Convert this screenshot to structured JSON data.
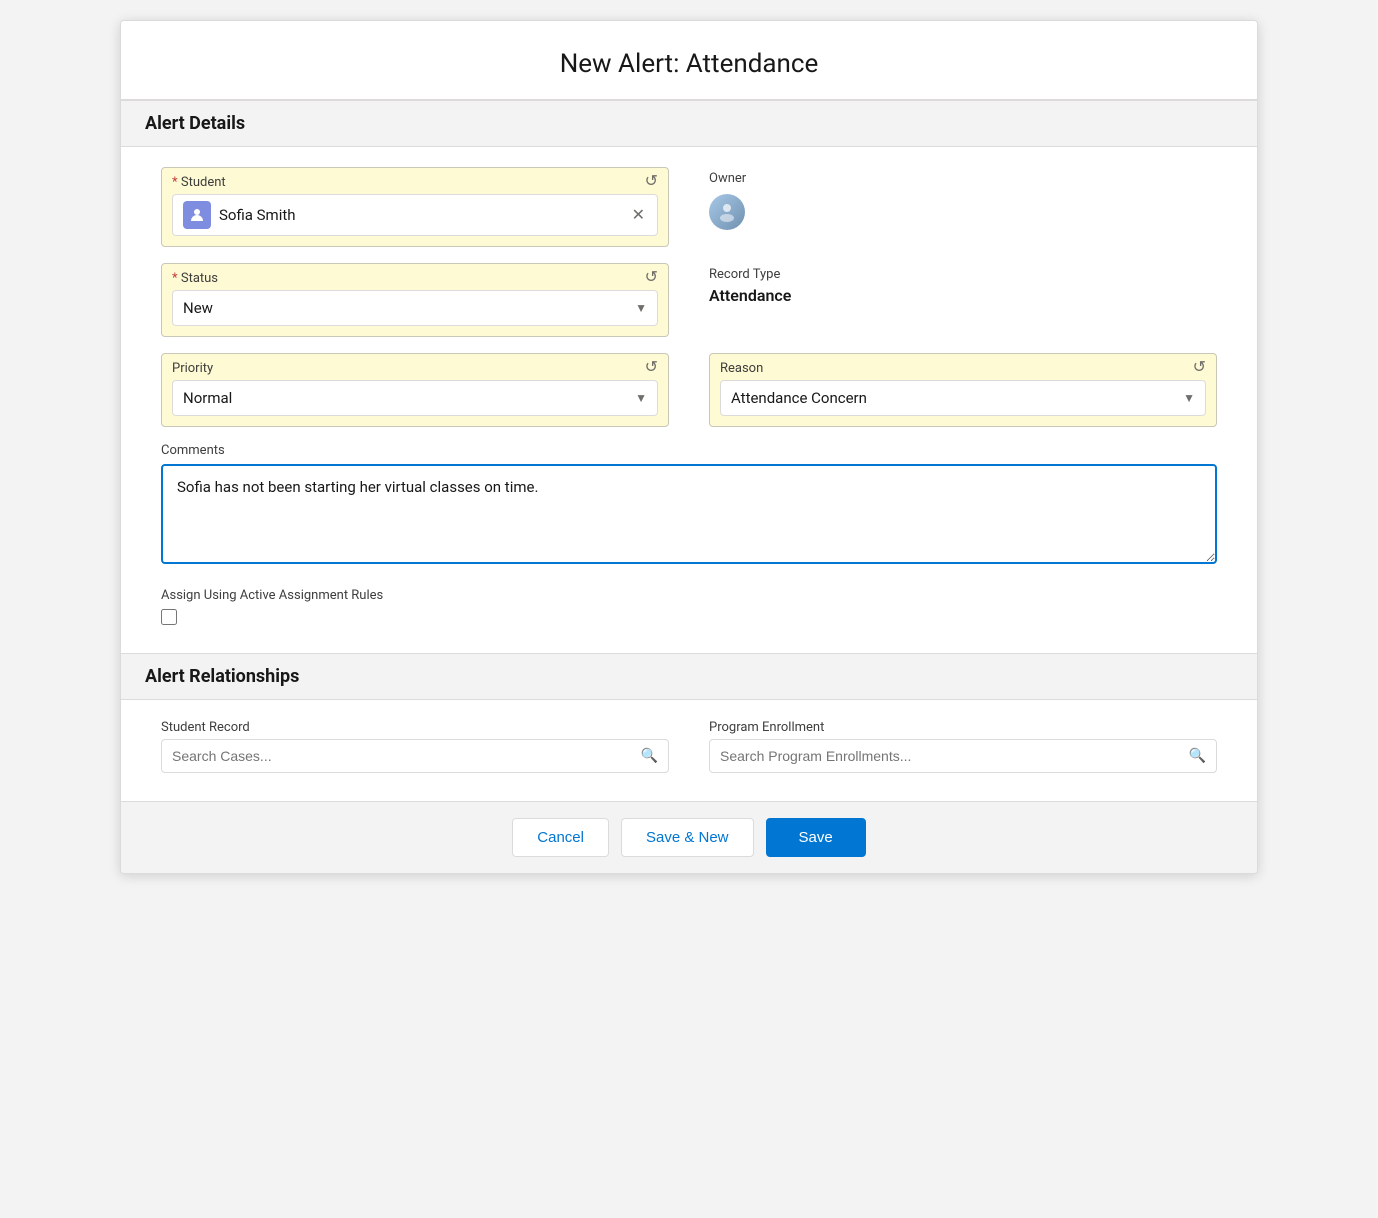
{
  "header": {
    "title": "New Alert: Attendance"
  },
  "alert_details": {
    "section_title": "Alert Details",
    "student": {
      "label": "Student",
      "required": true,
      "value": "Sofia Smith",
      "icon": "person-icon"
    },
    "status": {
      "label": "Status",
      "required": true,
      "value": "New"
    },
    "priority": {
      "label": "Priority",
      "required": false,
      "value": "Normal"
    },
    "owner": {
      "label": "Owner"
    },
    "record_type": {
      "label": "Record Type",
      "value": "Attendance"
    },
    "reason": {
      "label": "Reason",
      "value": "Attendance Concern"
    },
    "comments": {
      "label": "Comments",
      "value": "Sofia has not been starting her virtual classes on time."
    },
    "assign_rules": {
      "label": "Assign Using Active Assignment Rules"
    }
  },
  "alert_relationships": {
    "section_title": "Alert Relationships",
    "student_record": {
      "label": "Student Record",
      "placeholder": "Search Cases..."
    },
    "program_enrollment": {
      "label": "Program Enrollment",
      "placeholder": "Search Program Enrollments..."
    }
  },
  "footer": {
    "cancel_label": "Cancel",
    "save_new_label": "Save & New",
    "save_label": "Save"
  }
}
